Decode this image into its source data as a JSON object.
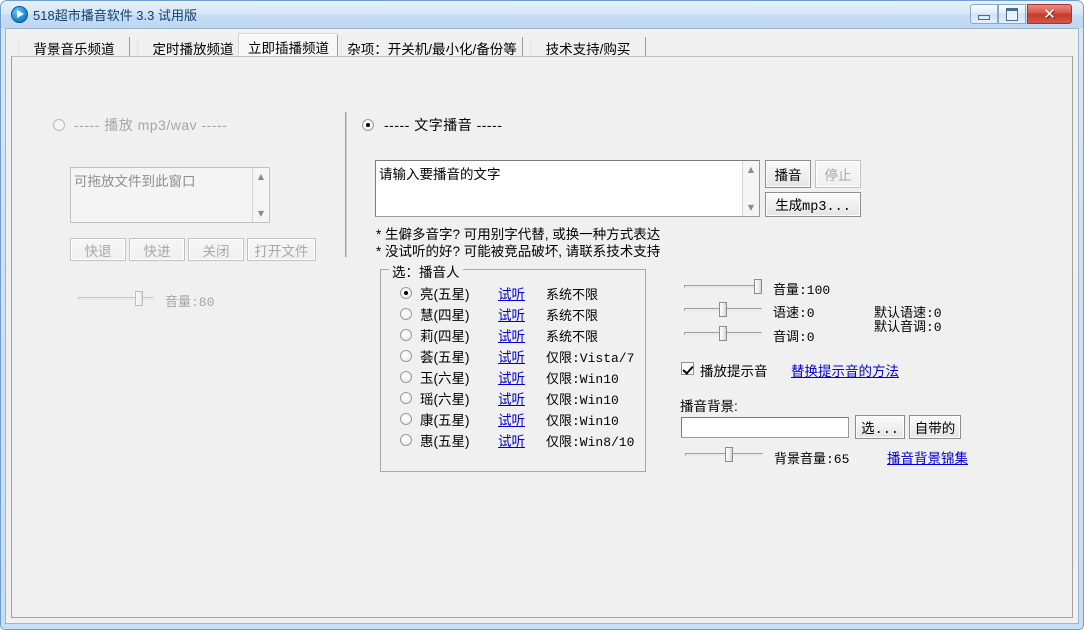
{
  "window": {
    "title": "518超市播音软件 3.3 试用版",
    "icon": "play-circle-icon",
    "controls": {
      "minimize": "minimize-button",
      "maximize": "maximize-button",
      "close": "close-button",
      "close_glyph": "✕"
    }
  },
  "tabs": [
    {
      "label": "背景音乐频道",
      "active": false
    },
    {
      "label": "定时播放频道",
      "active": false
    },
    {
      "label": "立即插播频道",
      "active": true
    },
    {
      "label": "杂项：开关机/最小化/备份等",
      "active": false
    },
    {
      "label": "技术支持/购买",
      "active": false
    }
  ],
  "left_panel": {
    "mode_radio": {
      "label": "----- 播放 mp3/wav -----",
      "checked": false,
      "enabled": false
    },
    "file_list": {
      "value": "可拖放文件到此窗口",
      "enabled": false
    },
    "buttons": [
      {
        "label": "快退",
        "enabled": false
      },
      {
        "label": "快进",
        "enabled": false
      },
      {
        "label": "关闭",
        "enabled": false
      },
      {
        "label": "打开文件",
        "enabled": false
      }
    ],
    "volume_slider": {
      "label": "音量:80",
      "value": 80,
      "enabled": false
    }
  },
  "right_panel": {
    "mode_radio": {
      "label": "----- 文字播音 -----",
      "checked": true,
      "enabled": true
    },
    "text_input": {
      "value": "请输入要播音的文字"
    },
    "play_button": {
      "label": "播音",
      "enabled": true
    },
    "stop_button": {
      "label": "停止",
      "enabled": false
    },
    "make_mp3_button": {
      "label": "生成mp3...",
      "enabled": true
    },
    "hints": [
      "* 生僻多音字? 可用别字代替, 或换一种方式表达",
      "* 没试听的好? 可能被竞品破坏, 请联系技术支持"
    ],
    "voice_group": {
      "title": "选：播音人",
      "preview_label": "试听",
      "voices": [
        {
          "name": "亮(五星)",
          "support": "系统不限",
          "checked": true
        },
        {
          "name": "慧(四星)",
          "support": "系统不限",
          "checked": false
        },
        {
          "name": "莉(四星)",
          "support": "系统不限",
          "checked": false
        },
        {
          "name": "荟(五星)",
          "support": "仅限:Vista/7",
          "checked": false
        },
        {
          "name": "玉(六星)",
          "support": "仅限:Win10",
          "checked": false
        },
        {
          "name": "瑶(六星)",
          "support": "仅限:Win10",
          "checked": false
        },
        {
          "name": "康(五星)",
          "support": "仅限:Win10",
          "checked": false
        },
        {
          "name": "惠(五星)",
          "support": "仅限:Win8/10",
          "checked": false
        }
      ]
    },
    "sliders": [
      {
        "label": "音量:100",
        "value": 100
      },
      {
        "label": "语速:0",
        "value": 50
      },
      {
        "label": "音调:0",
        "value": 50
      }
    ],
    "defaults": {
      "rate": "默认语速:0",
      "pitch": "默认音调:0"
    },
    "prompt_sound": {
      "label": "播放提示音",
      "checked": true
    },
    "replace_prompt_link": "替换提示音的方法",
    "background": {
      "title": "播音背景:",
      "path_value": "",
      "choose_button": "选...",
      "builtin_button": "自带的",
      "volume_label": "背景音量:65",
      "volume_value": 65,
      "collection_link": "播音背景锦集"
    }
  }
}
